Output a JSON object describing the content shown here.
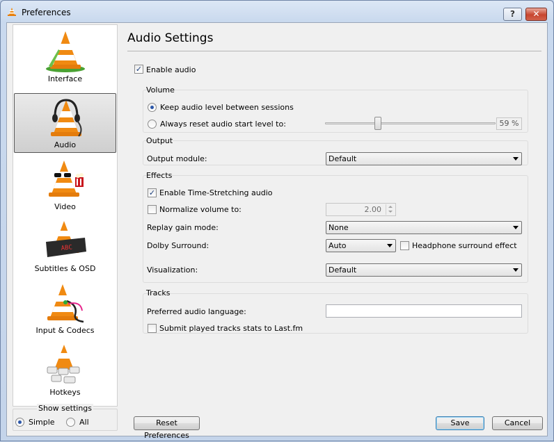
{
  "window": {
    "title": "Preferences",
    "help_label": "?",
    "close_label": "✕"
  },
  "sidebar": {
    "items": [
      {
        "id": "interface",
        "label": "Interface"
      },
      {
        "id": "audio",
        "label": "Audio",
        "selected": true
      },
      {
        "id": "video",
        "label": "Video"
      },
      {
        "id": "subtitles",
        "label": "Subtitles & OSD"
      },
      {
        "id": "input",
        "label": "Input & Codecs"
      },
      {
        "id": "hotkeys",
        "label": "Hotkeys"
      }
    ],
    "show_settings": {
      "title": "Show settings",
      "simple": "Simple",
      "all": "All",
      "selected": "Simple"
    }
  },
  "main": {
    "title": "Audio Settings",
    "enable_audio": {
      "label": "Enable audio",
      "checked": true
    },
    "volume": {
      "title": "Volume",
      "keep_level": {
        "label": "Keep audio level between sessions",
        "checked": true
      },
      "reset_level": {
        "label": "Always reset audio start level to:",
        "checked": false
      },
      "level_value": 59,
      "level_text": "59 %"
    },
    "output": {
      "title": "Output",
      "module_label": "Output module:",
      "module_value": "Default"
    },
    "effects": {
      "title": "Effects",
      "time_stretch": {
        "label": "Enable Time-Stretching audio",
        "checked": true
      },
      "normalize": {
        "label": "Normalize volume to:",
        "checked": false,
        "value": "2.00"
      },
      "replay_gain": {
        "label": "Replay gain mode:",
        "value": "None"
      },
      "dolby": {
        "label": "Dolby Surround:",
        "value": "Auto"
      },
      "headphone": {
        "label": "Headphone surround effect",
        "checked": false
      },
      "visualization": {
        "label": "Visualization:",
        "value": "Default"
      }
    },
    "tracks": {
      "title": "Tracks",
      "preferred_lang": {
        "label": "Preferred audio language:",
        "value": ""
      },
      "lastfm": {
        "label": "Submit played tracks stats to Last.fm",
        "checked": false
      }
    }
  },
  "footer": {
    "reset_label": "Reset Preferences",
    "save_label": "Save",
    "cancel_label": "Cancel"
  },
  "colors": {
    "cone_orange": "#f08a12",
    "accent_blue": "#2b56a8"
  }
}
